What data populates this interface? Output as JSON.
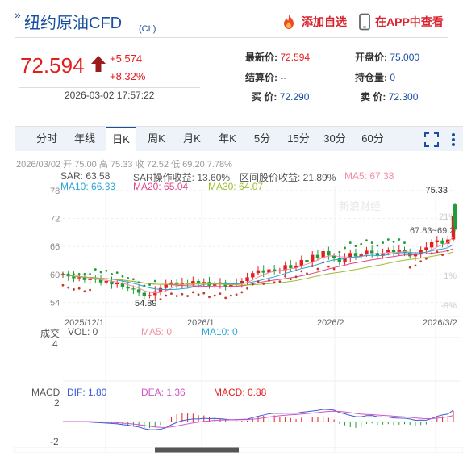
{
  "header": {
    "title": "纽约原油CFD",
    "title_suffix": "(CL)",
    "add_watchlist": "添加自选",
    "open_in_app": "在APP中查看"
  },
  "quote": {
    "price": "72.594",
    "change": "+5.574",
    "change_pct": "+8.32%",
    "timestamp": "2026-03-02 17:57:22",
    "fields": [
      {
        "label": "最新价:",
        "value": "72.594"
      },
      {
        "label": "开盘价:",
        "value": "75.000"
      },
      {
        "label": "结算价:",
        "value": "--"
      },
      {
        "label": "持仓量:",
        "value": "0"
      },
      {
        "label": "买 价:",
        "value": "72.290"
      },
      {
        "label": "卖 价:",
        "value": "72.300"
      }
    ]
  },
  "tabs": [
    "分时",
    "年线",
    "日K",
    "周K",
    "月K",
    "年K",
    "5分",
    "15分",
    "30分",
    "60分"
  ],
  "active_tab": "日K",
  "ohlc": {
    "date": "2026/03/02",
    "open_label": "开",
    "open": "75.00",
    "high_label": "高",
    "high": "75.33",
    "close_label": "收",
    "close": "72.52",
    "low_label": "低",
    "low": "69.20",
    "pct": "7.78%"
  },
  "indicators": {
    "sar": "SAR: 63.58",
    "sar_profit": "SAR操作收益: 13.60%",
    "range_profit": "区间股价收益: 21.89%",
    "ma5": "MA5: 67.38",
    "ma10": "MA10: 66.33",
    "ma20": "MA20: 65.04",
    "ma30": "MA30: 64.07"
  },
  "volume": {
    "label": "成交",
    "vol": "VOL: 0",
    "ma5": "MA5: 0",
    "ma10": "MA10: 0",
    "axis": "4"
  },
  "macd": {
    "label": "MACD",
    "dif": "DIF: 1.80",
    "dea": "DEA: 1.36",
    "macd": "MACD: 0.88",
    "axis_top": "2",
    "axis_bottom": "-2"
  },
  "price_axis": [
    "78",
    "72",
    "66",
    "60",
    "54"
  ],
  "pct_axis": [
    "21%",
    "1%",
    "-9%"
  ],
  "x_axis": [
    "2025/12/1",
    "2026/1",
    "2026/2",
    "2026/3/2"
  ],
  "annotations": {
    "high": "75.33",
    "low": "54.89",
    "range": "67.83~69.2"
  },
  "watermark": "新浪财经",
  "colors": {
    "up": "#e41d1d",
    "down": "#1f9b3a",
    "brand": "#1a4fa0",
    "ma5": "#f28ea0",
    "ma10": "#2aa6d6",
    "ma20": "#e0448a",
    "ma30": "#9bbf2e",
    "dif": "#3c5bd8",
    "dea": "#d054c8"
  },
  "chart_data": {
    "type": "candlestick",
    "ylim": [
      51,
      79
    ],
    "close_series": [
      60.1,
      59.6,
      59.2,
      59.4,
      58.8,
      59.1,
      58.9,
      58.3,
      58.6,
      57.9,
      58.2,
      57.4,
      57.0,
      56.8,
      56.1,
      55.4,
      55.6,
      56.4,
      57.1,
      57.9,
      58.3,
      57.8,
      58.2,
      57.8,
      58.6,
      58.1,
      58.4,
      57.6,
      57.9,
      58.3,
      57.4,
      57.9,
      58.1,
      58.6,
      59.4,
      60.3,
      60.9,
      60.4,
      61.1,
      60.7,
      60.9,
      62.0,
      61.4,
      61.9,
      63.1,
      62.6,
      64.2,
      63.6,
      65.0,
      64.1,
      63.6,
      62.6,
      63.5,
      64.6,
      63.9,
      64.3,
      65.1,
      64.6,
      64.0,
      64.6,
      65.3,
      64.8,
      65.3,
      64.6,
      63.9,
      64.3,
      65.2,
      65.8,
      66.9,
      67.3,
      66.6,
      67.5,
      72.5
    ],
    "high": 75.33,
    "low": 54.89
  }
}
